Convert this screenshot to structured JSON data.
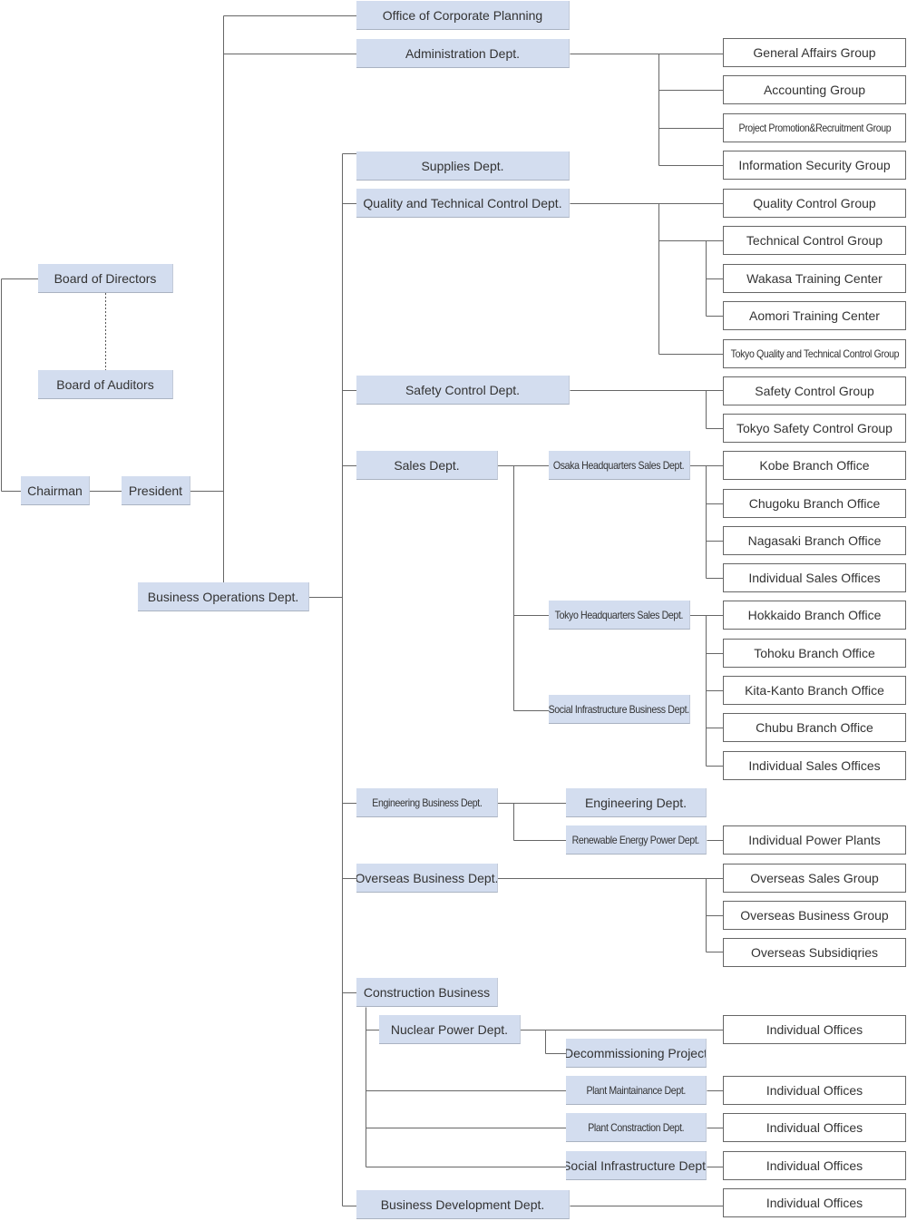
{
  "executive": {
    "board_of_directors": "Board of Directors",
    "board_of_auditors": "Board of Auditors",
    "chairman": "Chairman",
    "president": "President",
    "business_operations": "Business Operations Dept."
  },
  "departments": {
    "corporate_planning": "Office of Corporate Planning",
    "administration": "Administration Dept.",
    "supplies": "Supplies Dept.",
    "quality_technical": "Quality and Technical Control Dept.",
    "safety": "Safety Control Dept.",
    "sales": "Sales Dept.",
    "engineering_business": "Engineering Business Dept.",
    "overseas_business": "Overseas Business Dept.",
    "construction_business": "Construction Business",
    "nuclear_power": "Nuclear Power Dept.",
    "business_development": "Business Development Dept."
  },
  "sub_departments": {
    "osaka_hq_sales": "Osaka Headquarters Sales Dept.",
    "tokyo_hq_sales": "Tokyo Headquarters Sales Dept.",
    "social_infra_business": "Social Infrastructure Business Dept.",
    "engineering": "Engineering Dept.",
    "renewable_energy": "Renewable Energy Power Dept.",
    "decommissioning": "Decommissioning Project",
    "plant_maintenance": "Plant Maintainance Dept.",
    "plant_construction": "Plant Constraction Dept.",
    "social_infra": "Social Infrastructure Dept."
  },
  "groups": [
    "General Affairs Group",
    "Accounting Group",
    "Project Promotion&Recruitment Group",
    "Information Security Group",
    "Quality Control Group",
    "Technical Control Group",
    "Wakasa Training Center",
    "Aomori Training Center",
    "Tokyo Quality and Technical Control Group",
    "Safety Control Group",
    "Tokyo Safety Control Group",
    "Kobe Branch Office",
    "Chugoku Branch Office",
    "Nagasaki Branch Office",
    "Individual Sales Offices",
    "Hokkaido Branch Office",
    "Tohoku Branch Office",
    "Kita-Kanto Branch Office",
    "Chubu Branch Office",
    "Individual Sales Offices",
    "Individual Power Plants",
    "Overseas Sales Group",
    "Overseas Business Group",
    "Overseas Subsidiqries",
    "Individual Offices",
    "Individual Offices",
    "Individual Offices",
    "Individual Offices",
    "Individual Offices"
  ],
  "colors": {
    "unit_fill": "#d3ddef",
    "group_border": "#666666",
    "connector": "#666666"
  }
}
